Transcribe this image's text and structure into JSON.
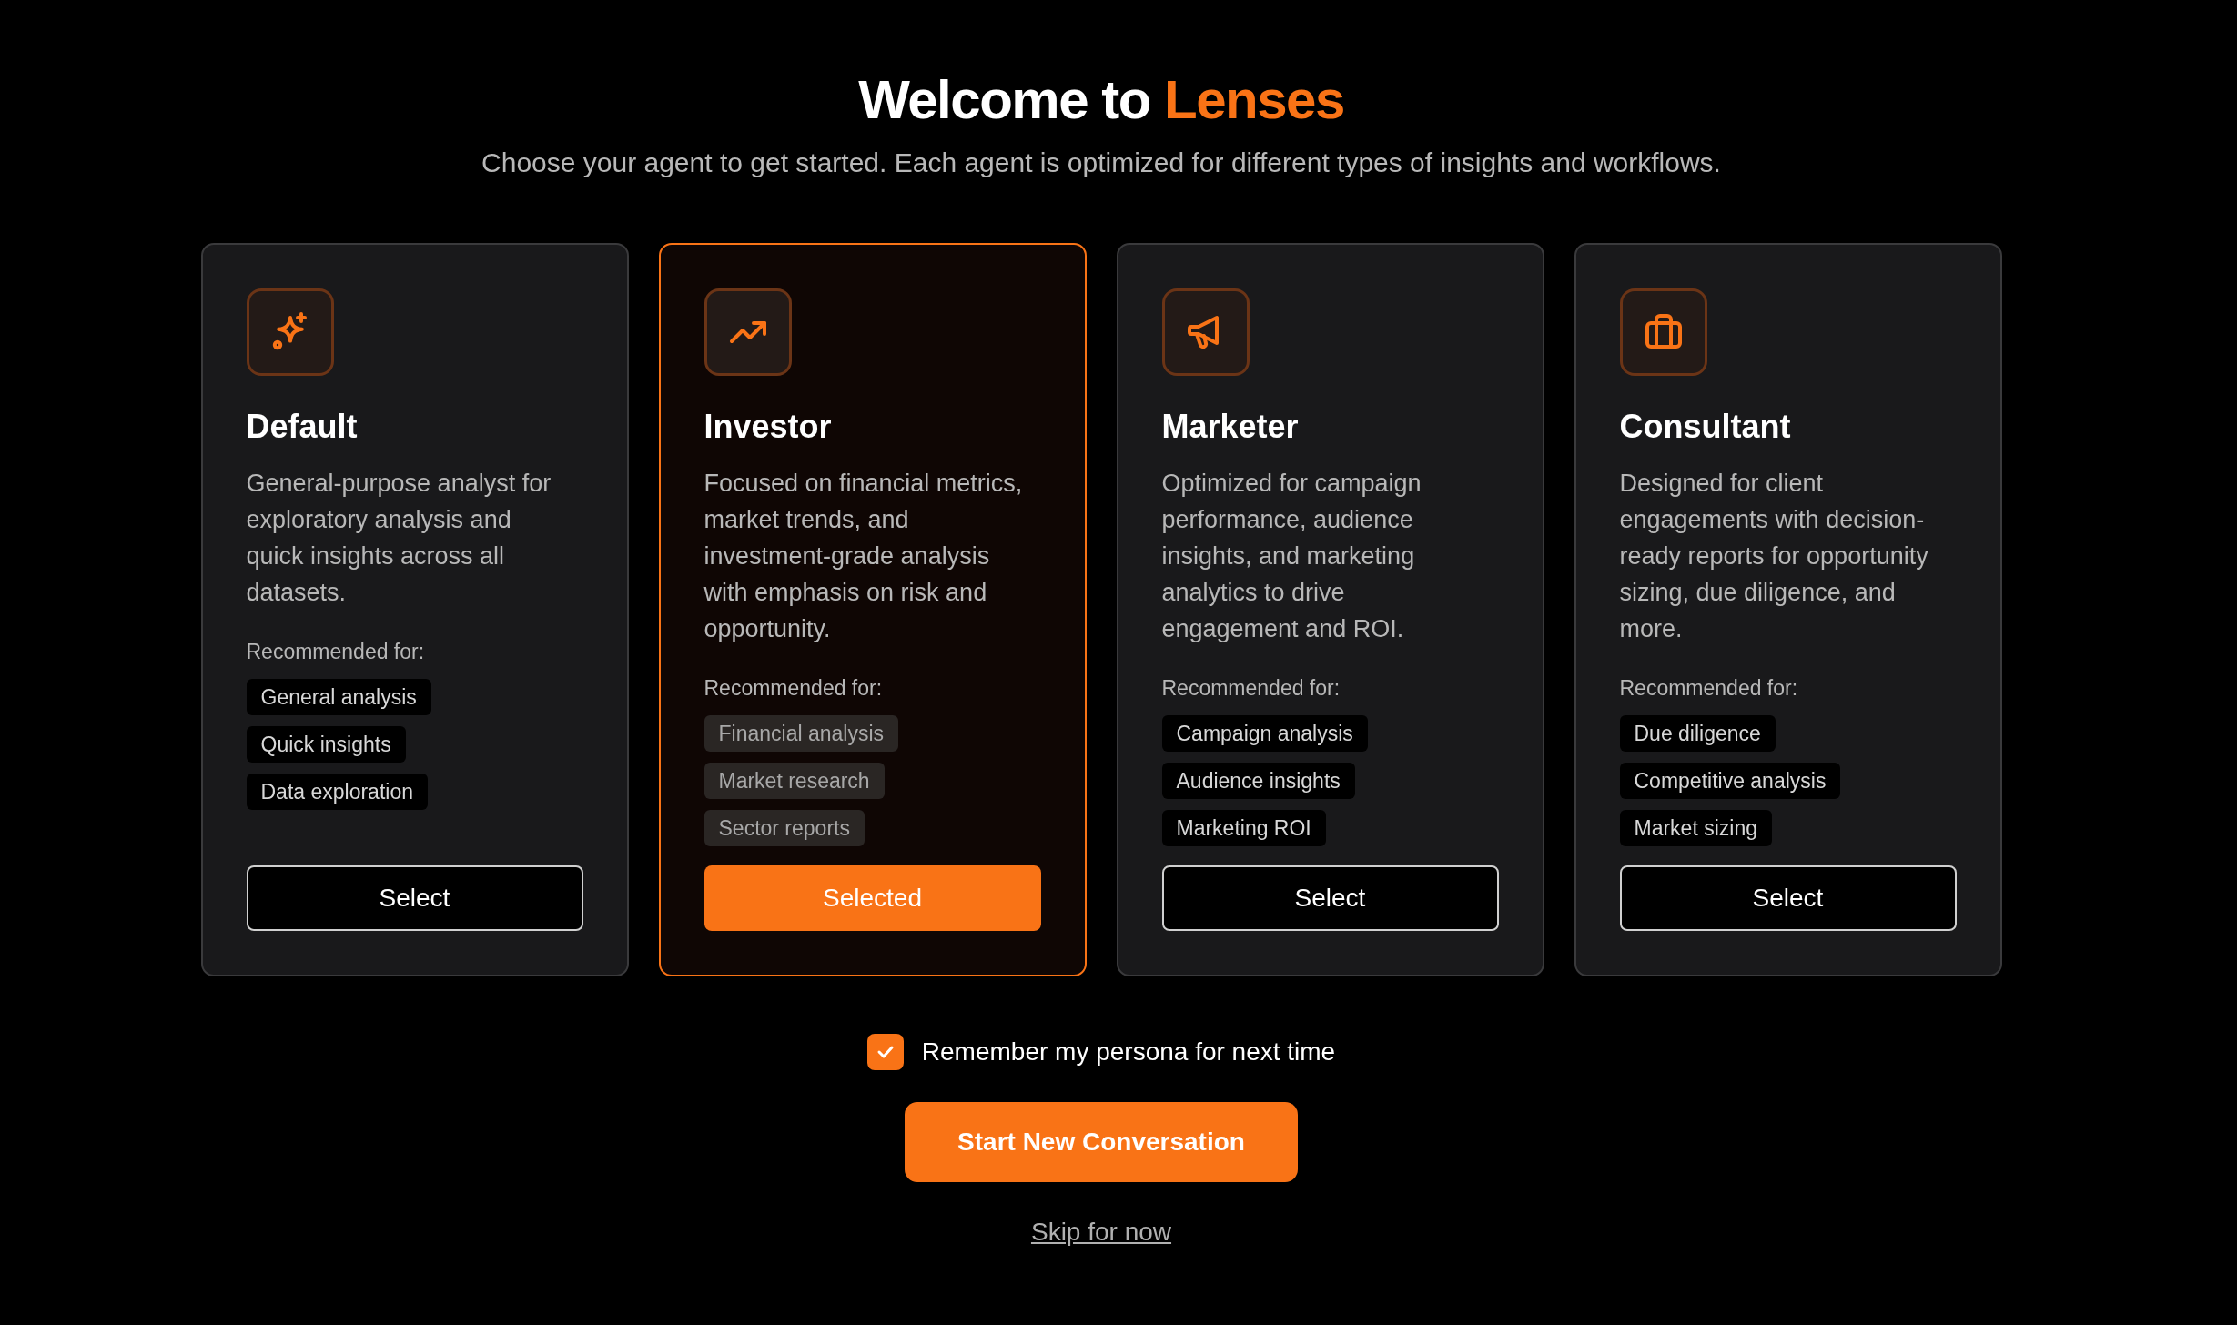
{
  "header": {
    "title_parts": [
      "Welcome to ",
      "Lenses"
    ],
    "subtitle": "Choose your agent to get started. Each agent is optimized for different types of insights and workflows."
  },
  "agents": [
    {
      "kind": "sparkles",
      "name": "Default",
      "description": "General-purpose analyst for exploratory analysis and quick insights across all datasets.",
      "recommended_label": "Recommended for:",
      "tags": [
        "General analysis",
        "Quick insights",
        "Data exploration"
      ],
      "button": "Select",
      "selected": false
    },
    {
      "kind": "trend",
      "name": "Investor",
      "description": "Focused on financial metrics, market trends, and investment-grade analysis with emphasis on risk and opportunity.",
      "recommended_label": "Recommended for:",
      "tags": [
        "Financial analysis",
        "Market research",
        "Sector reports"
      ],
      "button": "Selected",
      "selected": true
    },
    {
      "kind": "megaphone",
      "name": "Marketer",
      "description": "Optimized for campaign performance, audience insights, and marketing analytics to drive engagement and ROI.",
      "recommended_label": "Recommended for:",
      "tags": [
        "Campaign analysis",
        "Audience insights",
        "Marketing ROI"
      ],
      "button": "Select",
      "selected": false
    },
    {
      "kind": "briefcase",
      "name": "Consultant",
      "description": "Designed for client engagements with decision-ready reports for opportunity sizing, due diligence, and more.",
      "recommended_label": "Recommended for:",
      "tags": [
        "Due diligence",
        "Competitive analysis",
        "Market sizing"
      ],
      "button": "Select",
      "selected": false
    }
  ],
  "remember": {
    "label": "Remember my persona for next time",
    "checked": true
  },
  "start_button": "Start New Conversation",
  "skip_link": "Skip for now"
}
